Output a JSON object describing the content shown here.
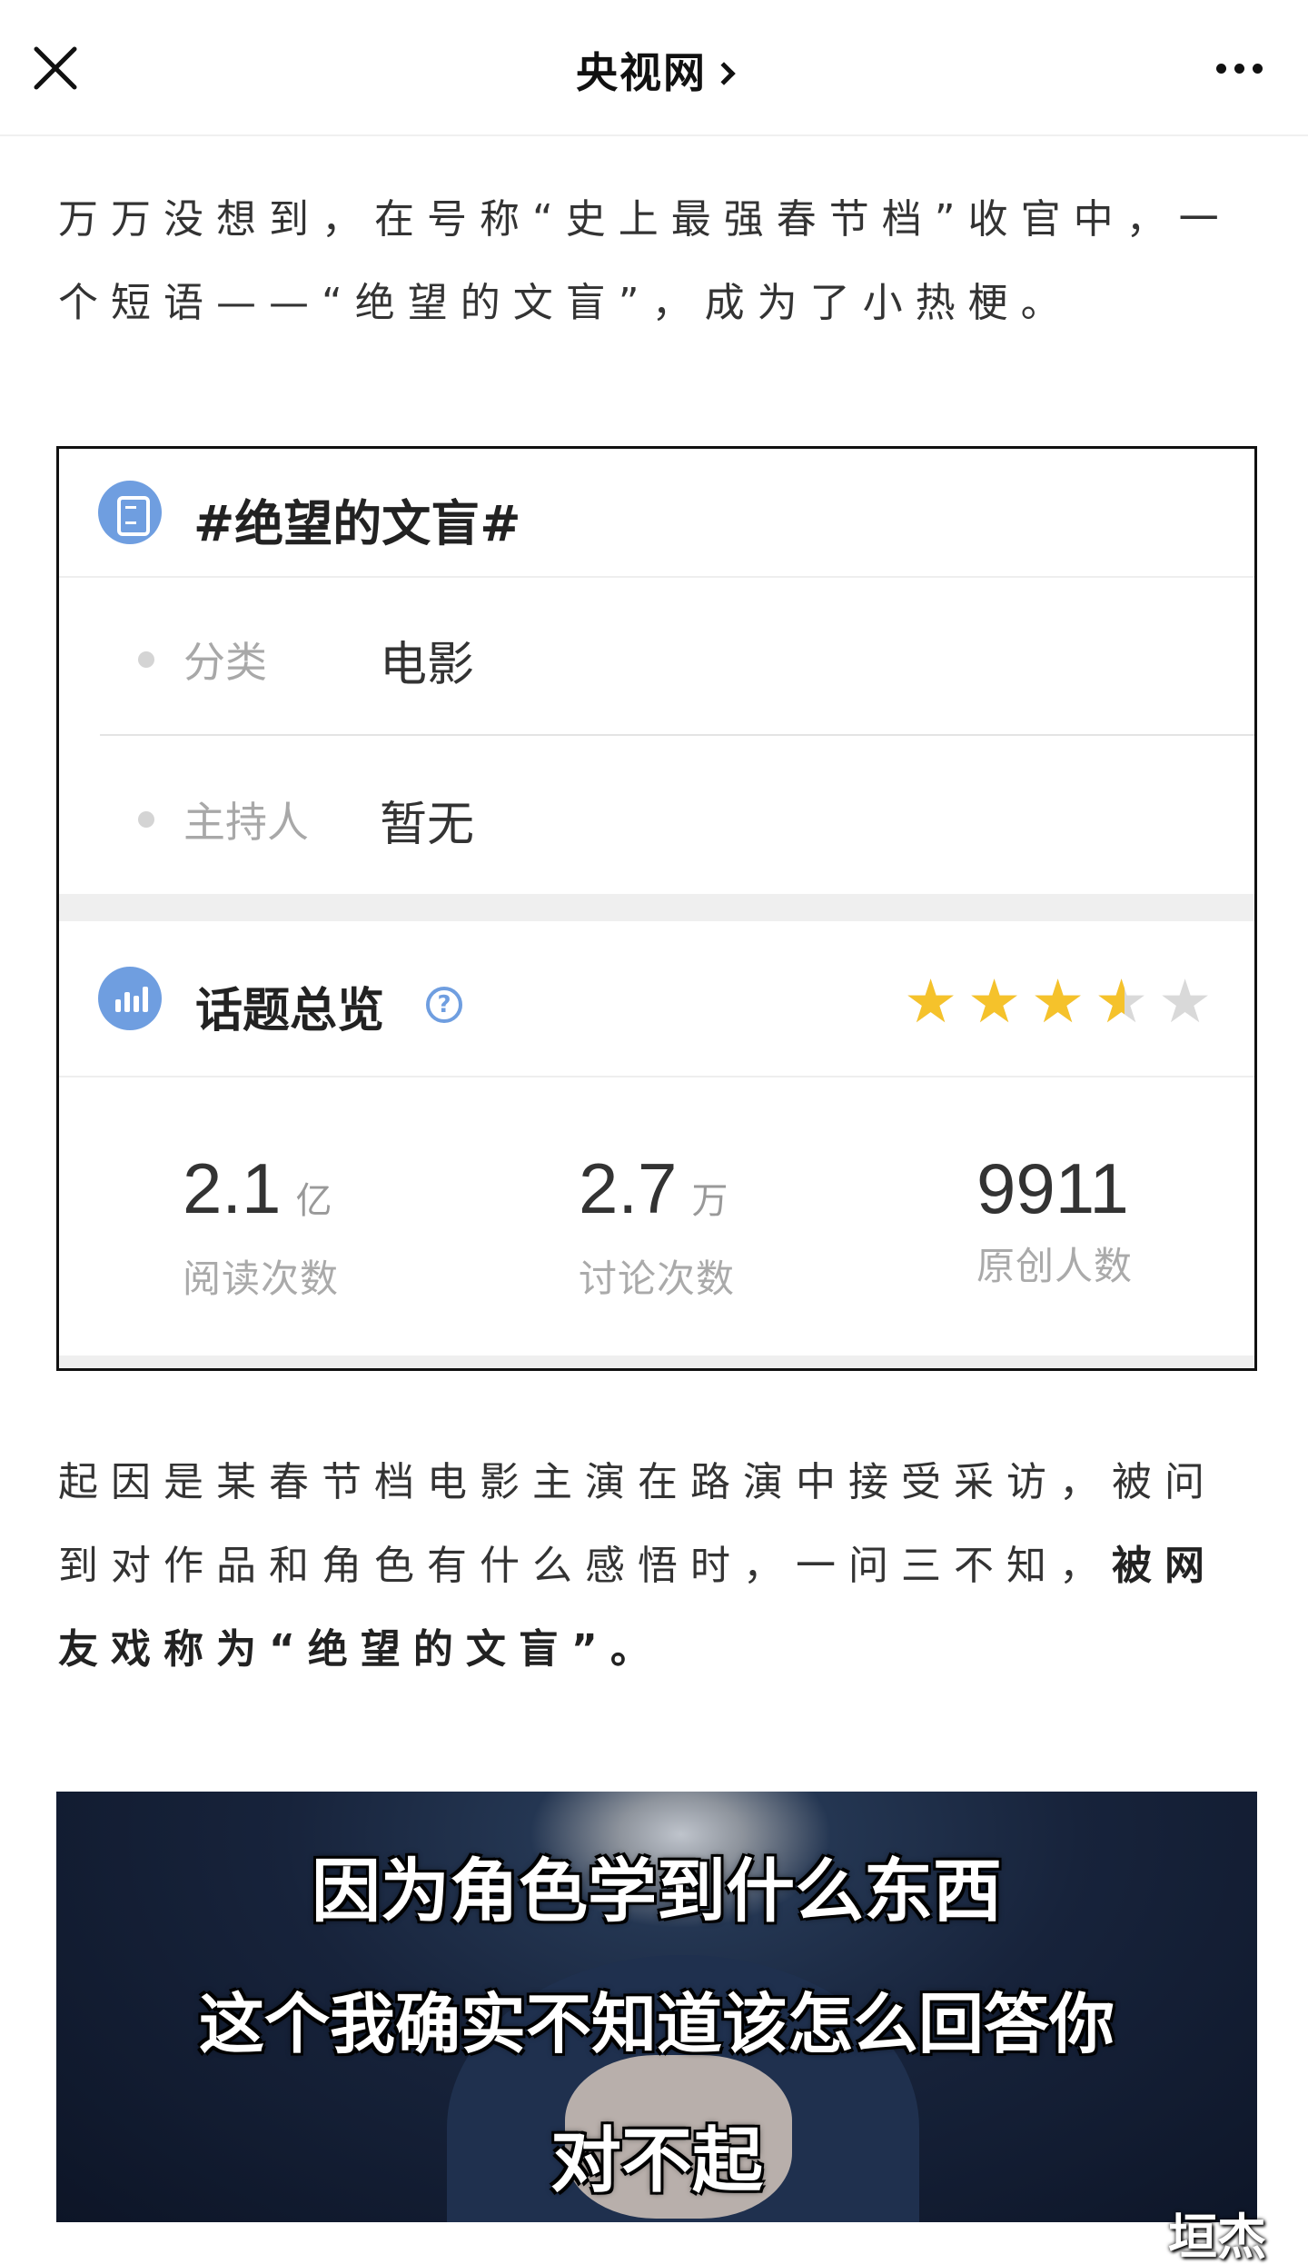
{
  "nav": {
    "title": "央视网",
    "close_icon": "close-icon",
    "more_icon": "more-dots-icon"
  },
  "article": {
    "paragraph1": "万万没想到，在号称“史上最强春节档”收官中，一个短语——“绝望的文盲”，成为了小热梗。",
    "paragraph2_plain": "起因是某春节档电影主演在路演中接受采访，被问到对作品和角色有什么感悟时，一问三不知，",
    "paragraph2_bold": "被网友戏称为“绝望的文盲”",
    "paragraph2_end": "。"
  },
  "topic_card": {
    "title": "#绝望的文盲#",
    "category_label": "分类",
    "category_value": "电影",
    "host_label": "主持人",
    "host_value": "暂无",
    "overview_title": "话题总览",
    "rating": 3.5,
    "rating_max": 5,
    "stats": [
      {
        "value": "2.1",
        "unit": "亿",
        "label": "阅读次数"
      },
      {
        "value": "2.7",
        "unit": "万",
        "label": "讨论次数"
      },
      {
        "value": "9911",
        "unit": "",
        "label": "原创人数"
      }
    ]
  },
  "video": {
    "caption1": "因为角色学到什么东西",
    "caption2": "这个我确实不知道该怎么回答你",
    "caption3": "对不起"
  },
  "watermark": "垣杰",
  "colors": {
    "accent_icon": "#6f9ee0",
    "star_filled": "#f5c22b",
    "star_empty": "#d9d9d9"
  }
}
